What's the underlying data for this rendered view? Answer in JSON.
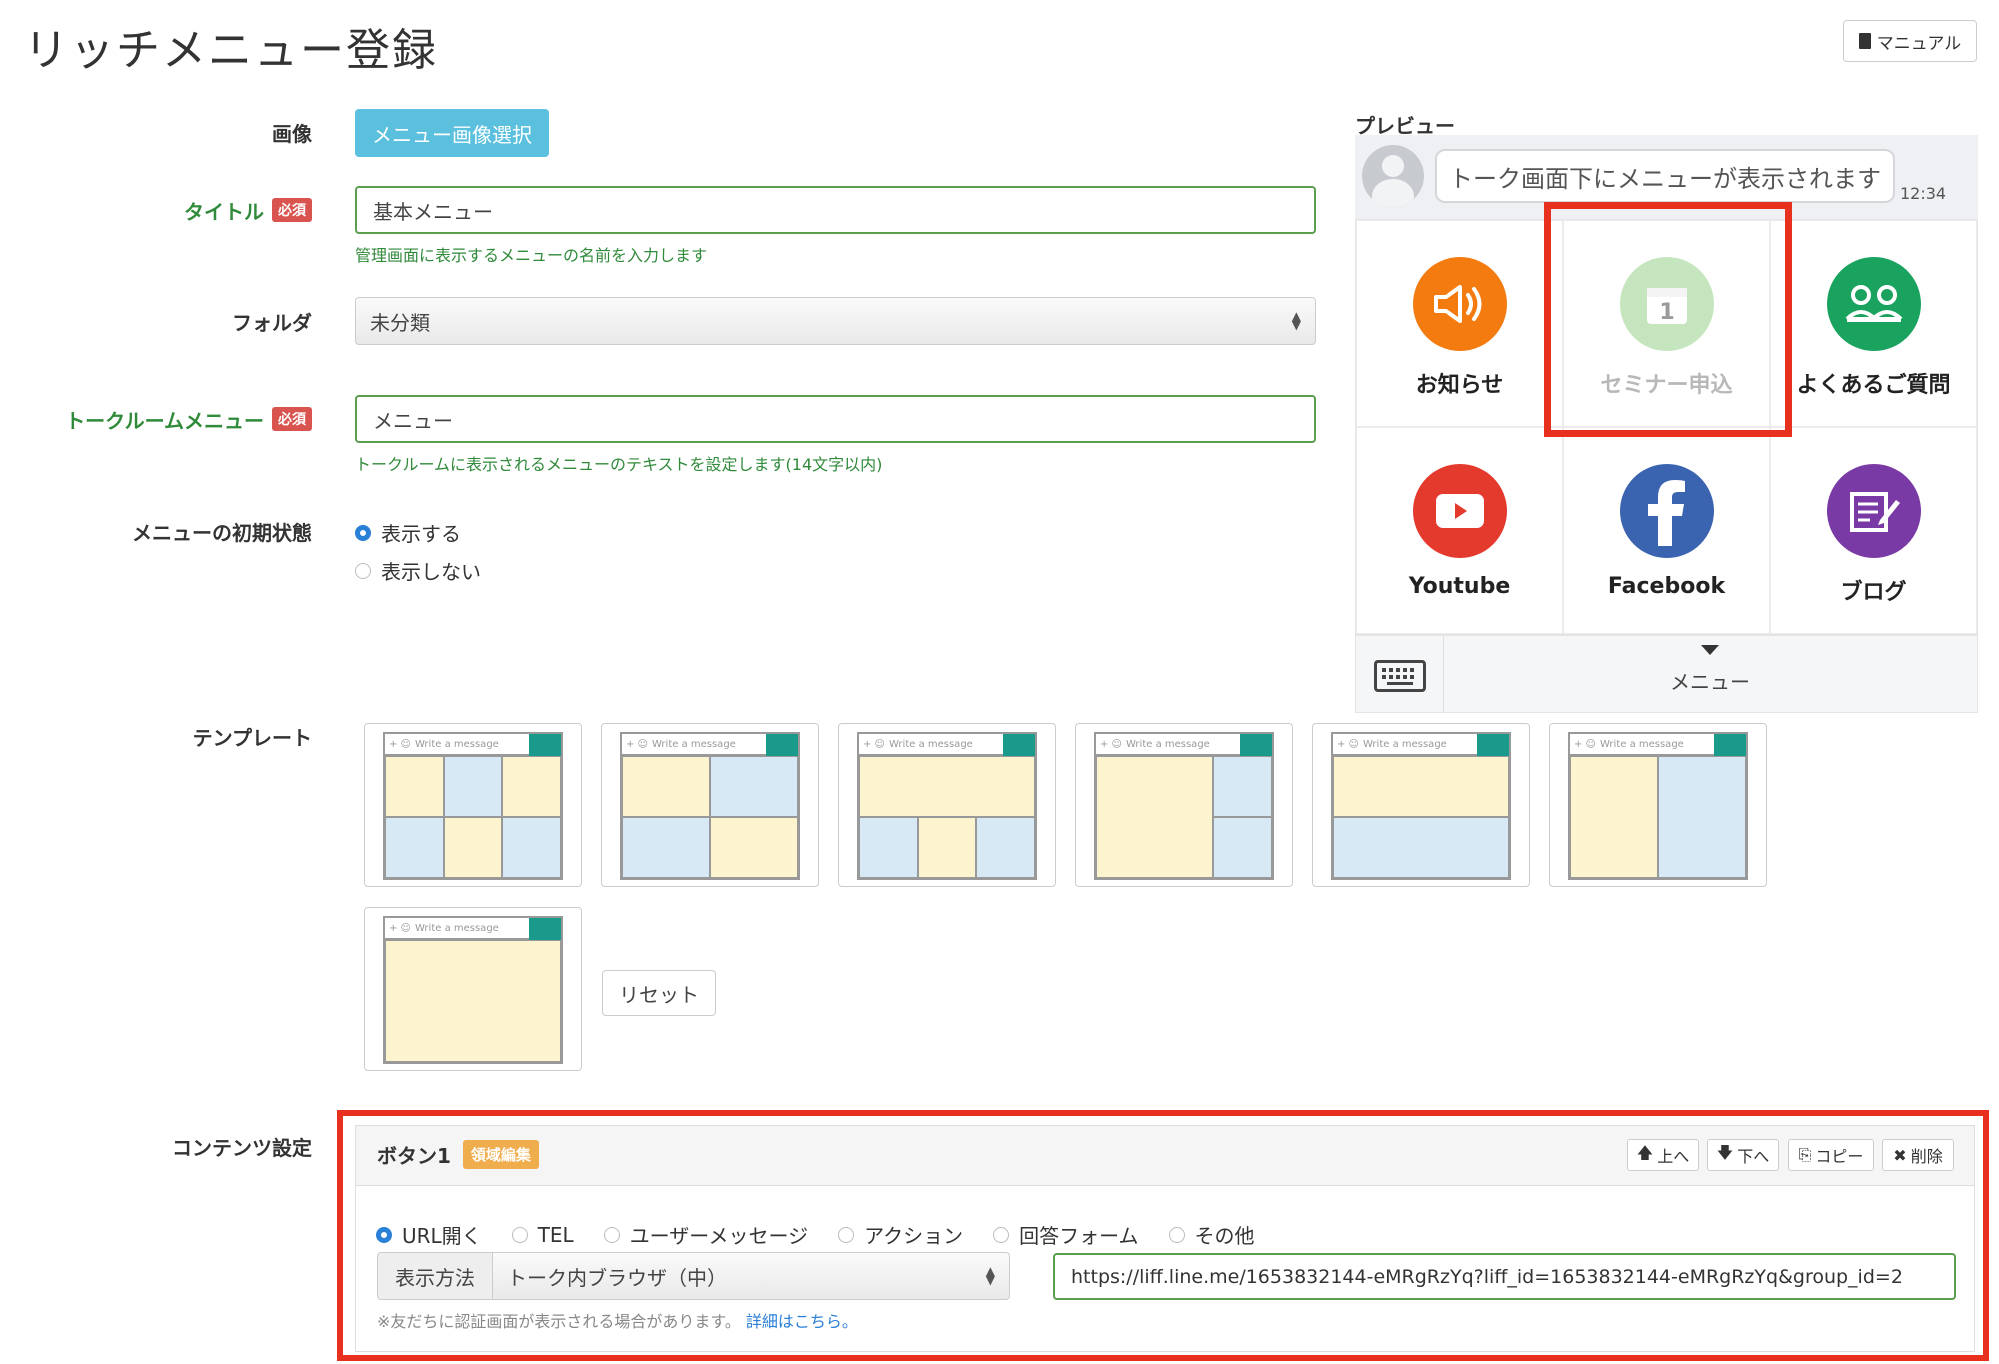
{
  "page": {
    "title": "リッチメニュー登録",
    "manual_label": "マニュアル"
  },
  "form": {
    "image": {
      "label": "画像",
      "button": "メニュー画像選択"
    },
    "title": {
      "label": "タイトル",
      "required": "必須",
      "value": "基本メニュー",
      "help": "管理画面に表示するメニューの名前を入力します"
    },
    "folder": {
      "label": "フォルダ",
      "selected": "未分類"
    },
    "talkroom_menu": {
      "label": "トークルームメニュー",
      "required": "必須",
      "value": "メニュー",
      "help": "トークルームに表示されるメニューのテキストを設定します(14文字以内)"
    },
    "initial_state": {
      "label": "メニューの初期状態",
      "options": [
        "表示する",
        "表示しない"
      ],
      "selected_index": 0
    },
    "template": {
      "label": "テンプレート",
      "bar_text": "Write a message",
      "reset": "リセット"
    }
  },
  "preview": {
    "label": "プレビュー",
    "bubble": "トーク画面下にメニューが表示されます",
    "time": "12:34",
    "cells": [
      {
        "label": "お知らせ",
        "icon": "megaphone-icon",
        "color": "#f47b10"
      },
      {
        "label": "セミナー申込",
        "icon": "calendar-icon",
        "color": "#7ec76f"
      },
      {
        "label": "よくあるご質問",
        "icon": "people-icon",
        "color": "#19a35e"
      },
      {
        "label": "Youtube",
        "icon": "youtube-icon",
        "color": "#e43a2e"
      },
      {
        "label": "Facebook",
        "icon": "facebook-icon",
        "color": "#3a64b0"
      },
      {
        "label": "ブログ",
        "icon": "blog-icon",
        "color": "#7a3aa6"
      }
    ],
    "menu_text": "メニュー"
  },
  "content_settings": {
    "label": "コンテンツ設定",
    "button_title": "ボタン1",
    "edit_badge": "領域編集",
    "actions": [
      "上へ",
      "下へ",
      "コピー",
      "削除"
    ],
    "type_options": [
      "URL開く",
      "TEL",
      "ユーザーメッセージ",
      "アクション",
      "回答フォーム",
      "その他"
    ],
    "selected_type_index": 0,
    "display_method_label": "表示方法",
    "display_method_value": "トーク内ブラウザ（中）",
    "url": "https://liff.line.me/1653832144-eMRgRzYq?liff_id=1653832144-eMRgRzYq&group_id=2",
    "note": "※友だちに認証画面が表示される場合があります。",
    "note_link": "詳細はこちら。"
  },
  "colors": {
    "required_badge": "#d9534f",
    "accent_blue": "#5bc0de",
    "highlight_red": "#e8301f",
    "green_label": "#2f8a3a",
    "template_yellow": "#fbf4cf",
    "template_blue": "#d6e9f5",
    "template_teal": "#1a9a8a"
  }
}
